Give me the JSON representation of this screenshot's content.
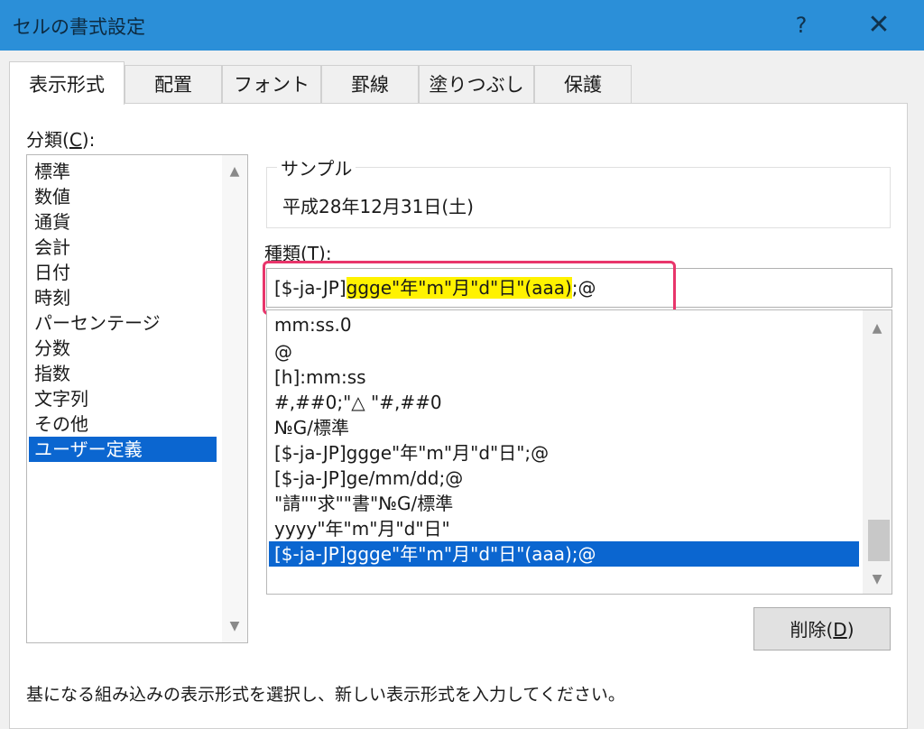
{
  "window": {
    "title": "セルの書式設定",
    "help_label": "?",
    "close_label": "✕"
  },
  "tabs": [
    {
      "label": "表示形式",
      "active": true
    },
    {
      "label": "配置"
    },
    {
      "label": "フォント"
    },
    {
      "label": "罫線"
    },
    {
      "label": "塗りつぶし"
    },
    {
      "label": "保護"
    }
  ],
  "category": {
    "label_prefix": "分類(",
    "label_key": "C",
    "label_suffix": "):",
    "items": [
      "標準",
      "数値",
      "通貨",
      "会計",
      "日付",
      "時刻",
      "パーセンテージ",
      "分数",
      "指数",
      "文字列",
      "その他",
      "ユーザー定義"
    ],
    "selected": "ユーザー定義"
  },
  "sample": {
    "legend": "サンプル",
    "value": "平成28年12月31日(土)"
  },
  "type": {
    "label_prefix": "種類(",
    "label_key": "T",
    "label_suffix": "):",
    "input_prefix": "[$-ja-JP]",
    "input_highlight": "ggge\"年\"m\"月\"d\"日\"(aaa)",
    "input_suffix": ";@"
  },
  "format_list": {
    "items": [
      "mm:ss.0",
      "@",
      "[h]:mm:ss",
      "#,##0;\"△ \"#,##0",
      "№G/標準",
      "[$-ja-JP]ggge\"年\"m\"月\"d\"日\";@",
      "[$-ja-JP]ge/mm/dd;@",
      "\"請\"\"求\"\"書\"№G/標準",
      "yyyy\"年\"m\"月\"d\"日\"",
      "[$-ja-JP]ggge\"年\"m\"月\"d\"日\"(aaa);@"
    ],
    "selected": "[$-ja-JP]ggge\"年\"m\"月\"d\"日\"(aaa);@"
  },
  "delete_button": {
    "label_prefix": "削除(",
    "label_key": "D",
    "label_suffix": ")"
  },
  "hint": "基になる組み込みの表示形式を選択し、新しい表示形式を入力してください。",
  "colors": {
    "titlebar": "#2b8fd8",
    "selection": "#0b66d0",
    "highlight": "#fff200",
    "annotation": "#e8356b"
  }
}
